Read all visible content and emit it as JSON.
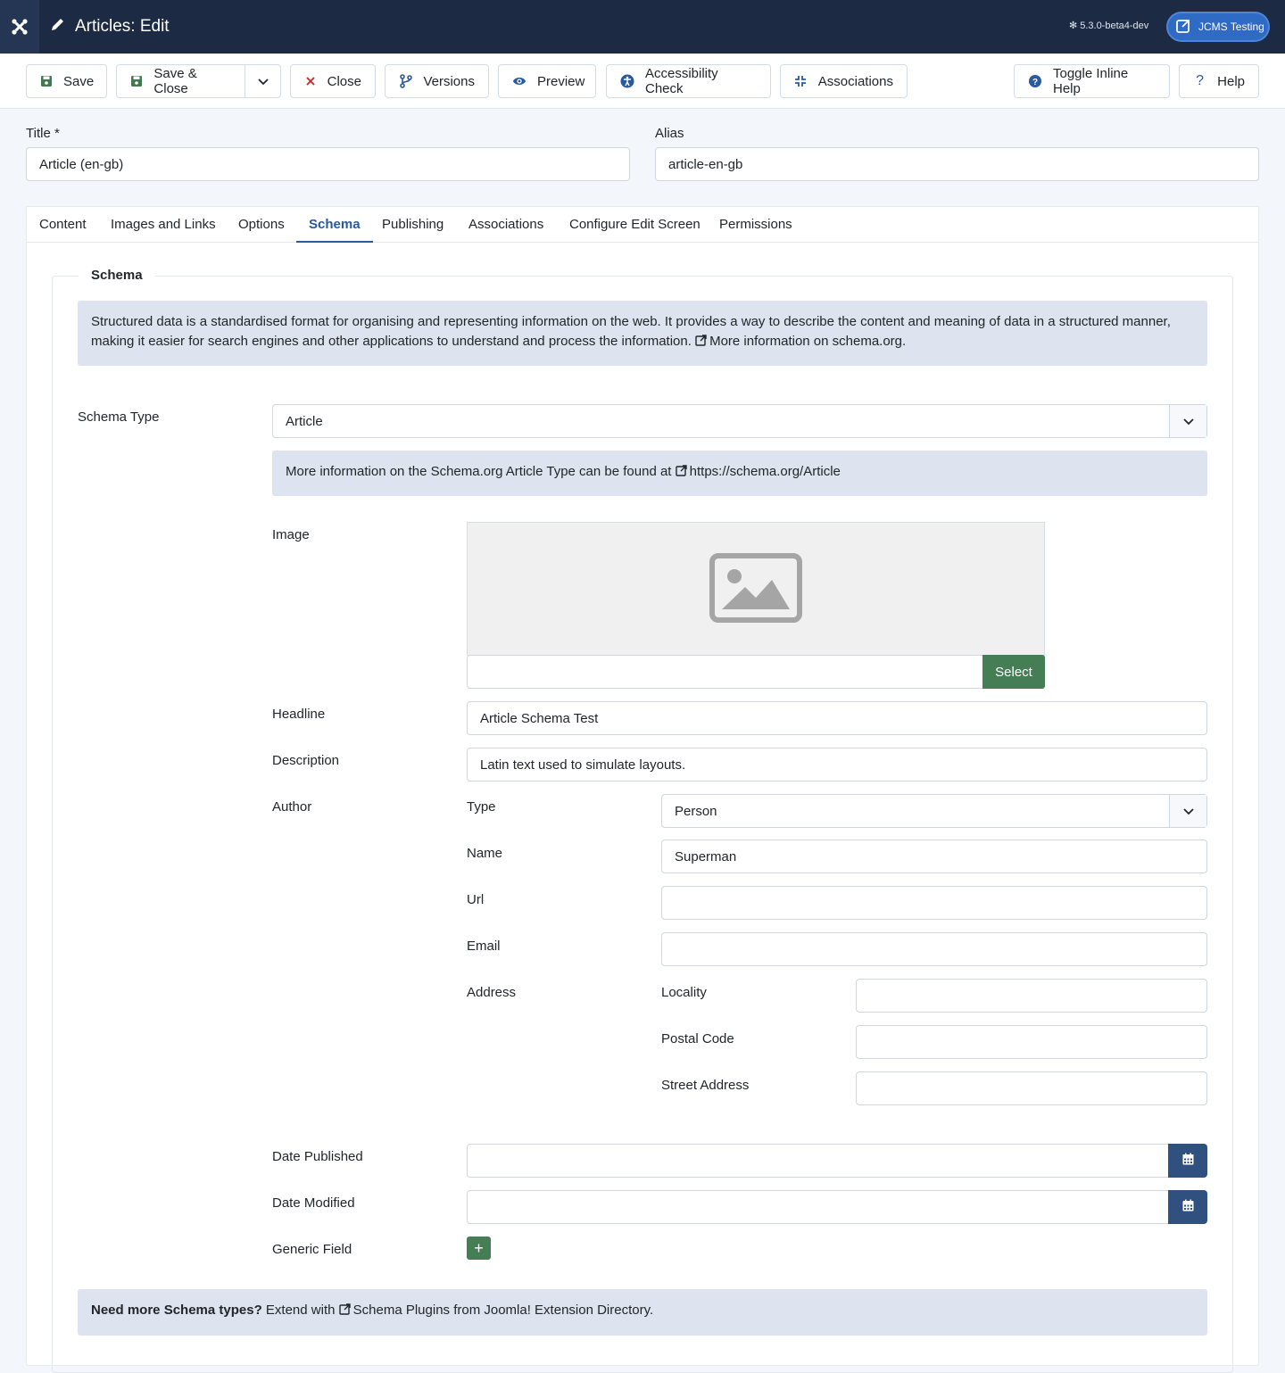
{
  "header": {
    "title": "Articles: Edit",
    "version": "5.3.0-beta4-dev",
    "site_button": "JCMS Testing"
  },
  "toolbar": {
    "save": "Save",
    "save_close": "Save & Close",
    "close": "Close",
    "versions": "Versions",
    "preview": "Preview",
    "accessibility": "Accessibility Check",
    "associations": "Associations",
    "toggle_help": "Toggle Inline Help",
    "help": "Help"
  },
  "form": {
    "title_label": "Title *",
    "title_value": "Article (en-gb)",
    "alias_label": "Alias",
    "alias_value": "article-en-gb"
  },
  "tabs": [
    "Content",
    "Images and Links",
    "Options",
    "Schema",
    "Publishing",
    "Associations",
    "Configure Edit Screen",
    "Permissions"
  ],
  "active_tab": "Schema",
  "schema": {
    "legend": "Schema",
    "intro_text": "Structured data is a standardised format for organising and representing information on the web. It provides a way to describe the content and meaning of data in a structured manner, making it easier for search engines and other applications to understand and process the information.",
    "intro_link": "More information on schema.org.",
    "type_label": "Schema Type",
    "type_value": "Article",
    "type_info_text": "More information on the Schema.org Article Type can be found at",
    "type_info_link": "https://schema.org/Article",
    "image_label": "Image",
    "select_button": "Select",
    "headline_label": "Headline",
    "headline_value": "Article Schema Test",
    "description_label": "Description",
    "description_value": "Latin text used to simulate layouts.",
    "author_label": "Author",
    "author_type_label": "Type",
    "author_type_value": "Person",
    "author_name_label": "Name",
    "author_name_value": "Superman",
    "author_url_label": "Url",
    "author_email_label": "Email",
    "address_label": "Address",
    "locality_label": "Locality",
    "postal_label": "Postal Code",
    "street_label": "Street Address",
    "date_published_label": "Date Published",
    "date_modified_label": "Date Modified",
    "generic_label": "Generic Field",
    "footer_bold": "Need more Schema types?",
    "footer_text": "Extend with",
    "footer_link": "Schema Plugins from Joomla! Extension Directory."
  },
  "colors": {
    "header_bg": "#1c2a44",
    "accent": "#2a5a9e",
    "green": "#457d54",
    "alert_bg": "#dde4ef"
  }
}
